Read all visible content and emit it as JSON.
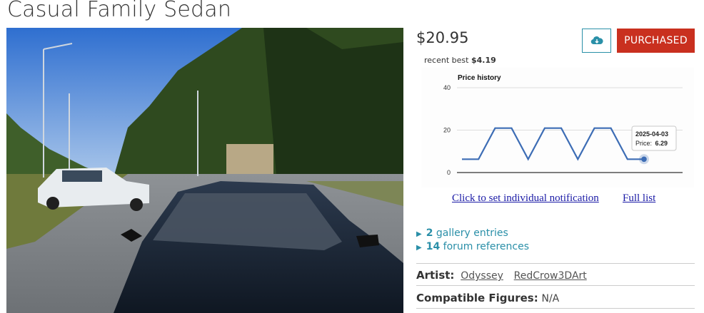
{
  "product": {
    "title": "Casual Family Sedan",
    "price": "$20.95",
    "recent_best_label": "recent best",
    "recent_best_value": "$4.19"
  },
  "actions": {
    "download_icon": "cloud-download-icon",
    "purchased_label": "PURCHASED"
  },
  "price_history": {
    "title": "Price history",
    "y_ticks": [
      "40",
      "20",
      "0"
    ],
    "tooltip_date": "2025-04-03",
    "tooltip_label": "Price:",
    "tooltip_value": "6.29",
    "line_color": "#3d6db5"
  },
  "chart_data": {
    "type": "line",
    "title": "Price history",
    "ylim": [
      0,
      40
    ],
    "grid": true,
    "series": [
      {
        "values": [
          6.29,
          6.29,
          20.95,
          20.95,
          6.29,
          20.95,
          20.95,
          6.29,
          20.95,
          20.95,
          6.29,
          6.29
        ]
      }
    ],
    "highlight": {
      "date": "2025-04-03",
      "price": 6.29
    }
  },
  "links": {
    "notification": "Click to set individual notification",
    "full_list": "Full list"
  },
  "entries": [
    {
      "count": "2",
      "label": "gallery entries"
    },
    {
      "count": "14",
      "label": "forum references"
    }
  ],
  "meta": {
    "artist_label": "Artist:",
    "artists": [
      "Odyssey",
      "RedCrow3DArt"
    ],
    "figures_label": "Compatible Figures:",
    "figures_value": "N/A"
  },
  "colors": {
    "accent": "#2a8fa8",
    "purchased": "#c9301f",
    "link": "#1a1aa6"
  }
}
